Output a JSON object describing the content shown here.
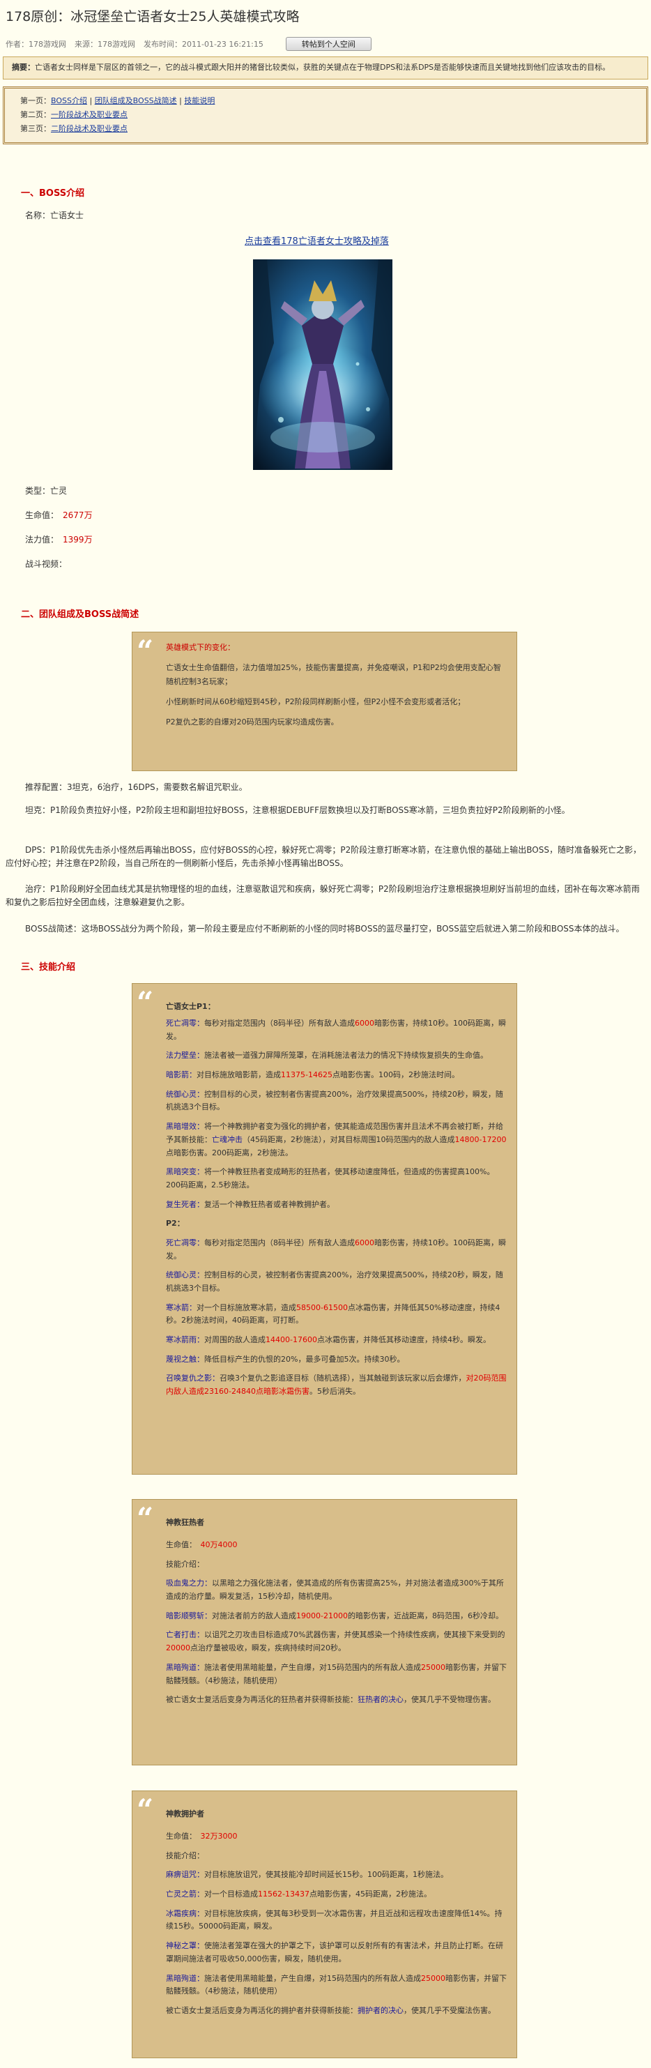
{
  "title": "178原创：冰冠堡垒亡语者女士25人英雄模式攻略",
  "meta": {
    "author": "作者：178游戏网",
    "source": "来源：178游戏网",
    "time": "发布时间：2011-01-23 16:21:15",
    "save": "转帖到个人空间"
  },
  "summary": {
    "label": "摘要：",
    "text": "亡语者女士同样是下层区的首领之一，它的战斗模式跟大阳并的猪督比较类似，获胜的关键点在于物理DPS和法系DPS是否能够快速而且关键地找到他们应该攻击的目标。"
  },
  "toc": [
    {
      "prefix": "第一页：",
      "links": [
        "BOSS介绍",
        "团队组成及BOSS战简述",
        "技能说明"
      ]
    },
    {
      "prefix": "第二页：",
      "links": [
        "一阶段战术及职业要点"
      ]
    },
    {
      "prefix": "第三页：",
      "links": [
        "二阶段战术及职业要点"
      ]
    }
  ],
  "s1": {
    "title": "一、BOSS介绍",
    "name": "名称：亡语女士",
    "link": "点击查看178亡语者女士攻略及掉落",
    "type": "类型：亡灵",
    "hp_label": "生命值：",
    "hp": "2677万",
    "mana_label": "法力值：",
    "mana": "1399万",
    "video": "战斗视频："
  },
  "s2": {
    "title": "二、团队组成及BOSS战简述",
    "quote": {
      "head": "英雄模式下的变化：",
      "l1": "亡语女士生命值翻倍，法力值增加25%，技能伤害量提高，并免疫嘲讽，P1和P2均会使用支配心智随机控制3名玩家；",
      "l2": "小怪刷新时间从60秒缩短到45秒，P2阶段同样刷新小怪，但P2小怪不会变形或者活化；",
      "l3": "P2复仇之影的自爆对20码范围内玩家均造成伤害。"
    },
    "p1": "推荐配置：3坦克，6治疗，16DPS，需要数名解诅咒职业。",
    "p2": "坦克：P1阶段负责拉好小怪，P2阶段主坦和副坦拉好BOSS，注意根据DEBUFF层数换坦以及打断BOSS寒冰箭，三坦负责拉好P2阶段刷新的小怪。",
    "p3": "DPS：P1阶段优先击杀小怪然后再输出BOSS，应付好BOSS的心控，躲好死亡凋零；P2阶段注意打断寒冰箭，在注意仇恨的基础上输出BOSS，随时准备躲死亡之影，应付好心控；并注意在P2阶段，当自己所在的一侧刷新小怪后，先击杀掉小怪再输出BOSS。",
    "p4": "治疗：P1阶段刷好全团血线尤其是抗物理怪的坦的血线，注意驱散诅咒和疾病，躲好死亡凋零；P2阶段刷坦治疗注意根据换坦刷好当前坦的血线，团补在每次寒冰箭雨和复仇之影后拉好全团血线，注意躲避复仇之影。",
    "p5": "BOSS战简述：这场BOSS战分为两个阶段，第一阶段主要是应付不断刷新的小怪的同时将BOSS的蓝尽量打空，BOSS蓝空后就进入第二阶段和BOSS本体的战斗。"
  },
  "s3": {
    "title": "三、技能介绍",
    "box1": {
      "p1_title": "亡语女士P1：",
      "p1": [
        {
          "n": "死亡凋零：",
          "t": "每秒对指定范围内（8码半径）所有敌人造成",
          "r": "6000",
          "t2": "暗影伤害，持续10秒。100码距离，瞬发。"
        },
        {
          "n": "法力壁垒：",
          "t": "施法者被一道强力屏障所笼罩，在消耗施法者法力的情况下持续恢复损失的生命值。"
        },
        {
          "n": "暗影箭：",
          "t": "对目标施放暗影箭，造成",
          "r": "11375-14625",
          "t2": "点暗影伤害。100码，2秒施法时间。"
        },
        {
          "n": "统御心灵：",
          "t": "控制目标的心灵，被控制者伤害提高200%，治疗效果提高500%，持续20秒，瞬发，随机挑选3个目标。"
        },
        {
          "n": "黑暗增效：",
          "t": "将一个神教拥护者变为强化的拥护者，使其能造成范围伤害并且法术不再会被打断，并给予其新技能：",
          "n2": "亡魂冲击",
          "t2": "（45码距离，2秒施法），对其目标周围10码范围内的敌人造成",
          "r": "14800-17200",
          "t3": "点暗影伤害。200码距离，2秒施法。"
        },
        {
          "n": "黑暗突变：",
          "t": "将一个神教狂热者变成畸形的狂热者，使其移动速度降低，但造成的伤害提高100%。200码距离，2.5秒施法。"
        },
        {
          "n": "复生死者：",
          "t": "复活一个神教狂热者或者神教拥护者。"
        }
      ],
      "p2_title": "P2：",
      "p2": [
        {
          "n": "死亡凋零：",
          "t": "每秒对指定范围内（8码半径）所有敌人造成",
          "r": "6000",
          "t2": "暗影伤害，持续10秒。100码距离，瞬发。"
        },
        {
          "n": "统御心灵：",
          "t": "控制目标的心灵，被控制者伤害提高200%，治疗效果提高500%，持续20秒，瞬发，随机挑选3个目标。"
        },
        {
          "n": "寒冰箭：",
          "t": "对一个目标施放寒冰箭，造成",
          "r": "58500-61500",
          "t2": "点冰霜伤害，并降低其50%移动速度，持续4秒。2秒施法时间，40码距离，可打断。"
        },
        {
          "n": "寒冰箭雨：",
          "t": "对周围的敌人造成",
          "r": "14400-17600",
          "t2": "点冰霜伤害，并降低其移动速度，持续4秒。瞬发。"
        },
        {
          "n": "蔑视之触：",
          "t": "降低目标产生的仇恨的20%，最多可叠加5次。持续30秒。"
        },
        {
          "n": "召唤复仇之影：",
          "t": "召唤3个复仇之影追逐目标（随机选择），当其触碰到该玩家以后会爆炸，",
          "r": "对20码范围内敌人造成23160-24840点暗影冰霜伤害",
          "t2": "。5秒后消失。"
        }
      ]
    },
    "box2": {
      "title": "神教狂热者",
      "hp_l": "生命值：",
      "hp": "40万4000",
      "sk": "技能介绍：",
      "items": [
        {
          "n": "吸血鬼之力：",
          "t": "以黑暗之力强化施法者，使其造成的所有伤害提高25%，并对施法者造成300%于其所造成的治疗量。瞬发复活，15秒冷却，随机使用。"
        },
        {
          "n": "暗影顺劈斩：",
          "t": "对施法者前方的敌人造成",
          "r": "19000-21000",
          "t2": "的暗影伤害，近战距离，8码范围，6秒冷却。"
        },
        {
          "n": "亡者打击：",
          "t": "以诅咒之刃攻击目标造成70%武器伤害，并使其感染一个持续性疾病，使其接下来受到的",
          "r": "20000",
          "t2": "点治疗量被吸收，瞬发，疾病持续时间20秒。"
        },
        {
          "n": "黑暗殉道：",
          "t": "施法者使用黑暗能量，产生自爆，对15码范围内的所有敌人造成",
          "r": "25000",
          "t2": "暗影伤害，并留下骷髅残骸。（4秒施法，随机使用）"
        },
        {
          "t": "被亡语女士复活后变身为再活化的狂热者并获得新技能：",
          "n": "狂热者的决心",
          "t2": "，使其几乎不受物理伤害。"
        }
      ]
    },
    "box3": {
      "title": "神教拥护者",
      "hp_l": "生命值：",
      "hp": "32万3000",
      "sk": "技能介绍：",
      "items": [
        {
          "n": "麻痹诅咒：",
          "t": "对目标施放诅咒，使其技能冷却时间延长15秒。100码距离，1秒施法。"
        },
        {
          "n": "亡灵之箭：",
          "t": "对一个目标造成",
          "r": "11562-13437",
          "t2": "点暗影伤害，45码距离，2秒施法。"
        },
        {
          "n": "冰霜疾病：",
          "t": "对目标施放疾病，使其每3秒受到一次冰霜伤害，并且近战和远程攻击速度降低14%。持续15秒。50000码距离，瞬发。"
        },
        {
          "n": "神秘之罩：",
          "t": "使施法者笼罩在强大的护罩之下，该护罩可以反射所有的有害法术，并且防止打断。在研罩期间施法者可吸收50,000伤害，瞬发，随机使用。"
        },
        {
          "n": "黑暗殉道：",
          "t": "施法者使用黑暗能量，产生自爆，对15码范围内的所有敌人造成",
          "r": "25000",
          "t2": "暗影伤害，并留下骷髅残骸。（4秒施法，随机使用）"
        },
        {
          "t": "被亡语女士复活后变身为再活化的拥护者并获得新技能：",
          "n": "拥护者的决心",
          "t2": "，使其几乎不受魔法伤害。"
        }
      ]
    }
  }
}
